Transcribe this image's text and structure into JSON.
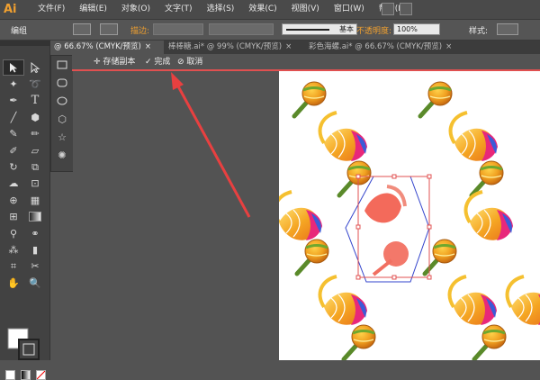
{
  "app": {
    "logo": "Ai"
  },
  "menu": [
    "文件(F)",
    "编辑(E)",
    "对象(O)",
    "文字(T)",
    "选择(S)",
    "效果(C)",
    "视图(V)",
    "窗口(W)",
    "帮助(H)"
  ],
  "control": {
    "mode_label": "编组",
    "stroke_label": "描边:",
    "stroke_style": "基本",
    "opacity_label": "不透明度:",
    "opacity_value": "100%",
    "style_label": "样式:"
  },
  "tabs": [
    {
      "label": "@ 66.67% (CMYK/预览)",
      "active": true
    },
    {
      "label": "棒棒糖.ai* @ 99% (CMYK/预览)",
      "active": false
    },
    {
      "label": "彩色海螺.ai* @ 66.67% (CMYK/预览)",
      "active": false
    }
  ],
  "isolation": {
    "save_copy": "存储副本",
    "done": "完成",
    "cancel": "取消"
  },
  "colors": {
    "accent_orange": "#f0a030",
    "isolation_line": "#e05050",
    "arrow_red": "#e84040",
    "selection_blue": "#3344cc",
    "selection_red": "#e05050"
  },
  "tools": [
    "selection-icon",
    "direct-selection-icon",
    "magic-wand-icon",
    "lasso-icon",
    "pen-icon",
    "type-icon",
    "line-icon",
    "shape-icon",
    "paintbrush-icon",
    "pencil-icon",
    "blob-brush-icon",
    "eraser-icon",
    "rotate-icon",
    "scale-icon",
    "warp-icon",
    "free-transform-icon",
    "shape-builder-icon",
    "perspective-icon",
    "mesh-icon",
    "gradient-icon",
    "eyedropper-icon",
    "blend-icon",
    "symbol-sprayer-icon",
    "graph-icon",
    "artboard-icon",
    "slice-icon",
    "hand-icon",
    "zoom-icon"
  ],
  "flyout_tools": [
    "rectangle-icon",
    "rounded-rectangle-icon",
    "ellipse-icon",
    "polygon-icon",
    "star-icon",
    "flare-icon"
  ]
}
